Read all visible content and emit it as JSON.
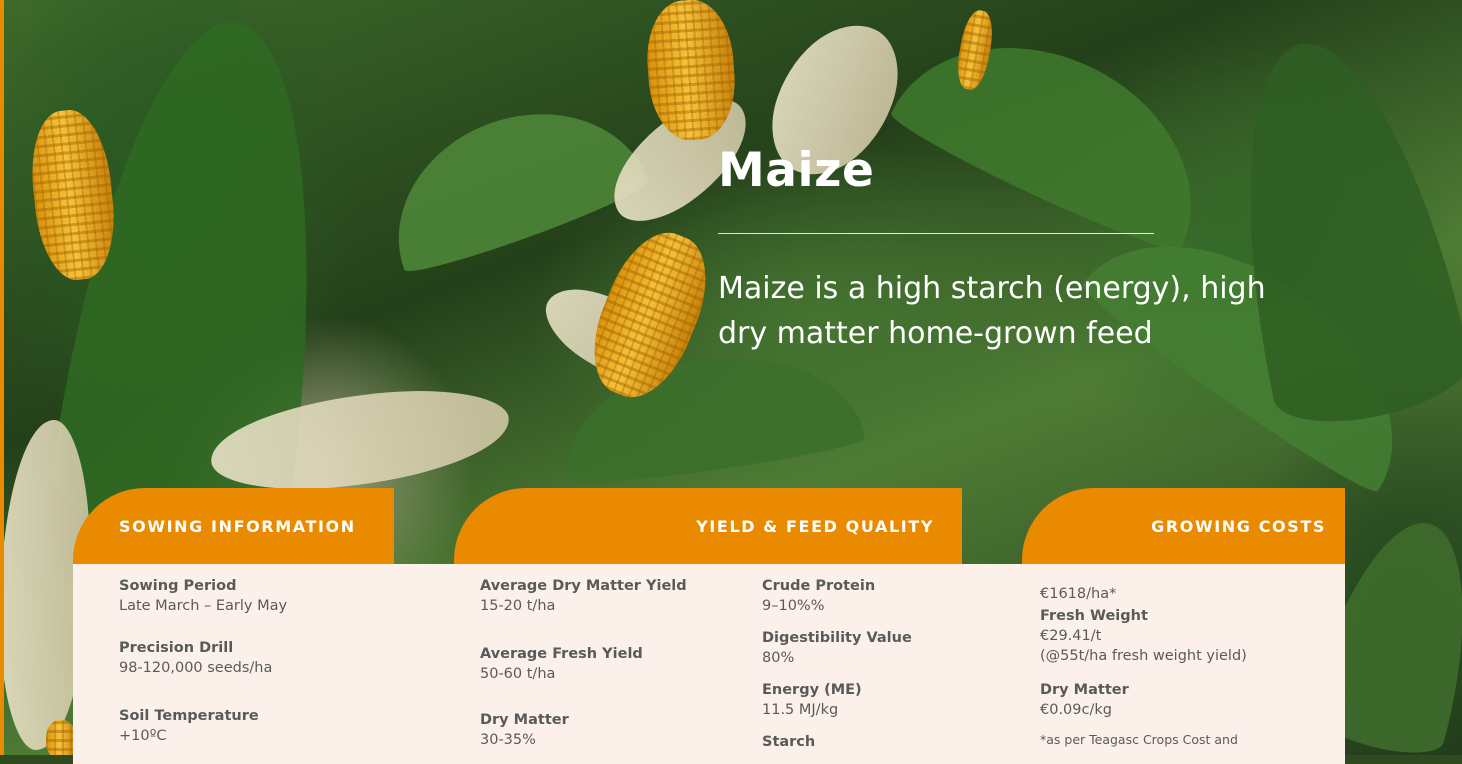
{
  "hero": {
    "title": "Maize",
    "subtitle": "Maize is a high starch (energy), high dry matter home-grown feed"
  },
  "colors": {
    "accent": "#ea8a00",
    "panel_bg": "#fbf1ea",
    "text": "#5a5a5a"
  },
  "sowing": {
    "heading": "SOWING INFORMATION",
    "items": [
      {
        "label": "Sowing Period",
        "value": "Late March – Early May"
      },
      {
        "label": "Precision Drill",
        "value": "98-120,000 seeds/ha"
      },
      {
        "label": "Soil Temperature",
        "value": "+10ºC"
      }
    ]
  },
  "yield": {
    "heading": "YIELD & FEED QUALITY",
    "left_items": [
      {
        "label": "Average Dry Matter Yield",
        "value": "15-20 t/ha"
      },
      {
        "label": "Average Fresh Yield",
        "value": "50-60 t/ha"
      },
      {
        "label": "Dry Matter",
        "value": "30-35%"
      }
    ],
    "right_items": [
      {
        "label": "Crude Protein",
        "value": "9–10%%"
      },
      {
        "label": "Digestibility Value",
        "value": "80%"
      },
      {
        "label": "Energy (ME)",
        "value": "11.5 MJ/kg"
      },
      {
        "label": "Starch",
        "value": ""
      }
    ]
  },
  "costs": {
    "heading": "GROWING COSTS",
    "total": "€1618/ha*",
    "fresh_label": "Fresh Weight",
    "fresh_value": "€29.41/t",
    "fresh_note": "(@55t/ha fresh weight yield)",
    "dry_label": "Dry Matter",
    "dry_value": "€0.09c/kg",
    "footnote": "*as per Teagasc Crops Cost and"
  }
}
